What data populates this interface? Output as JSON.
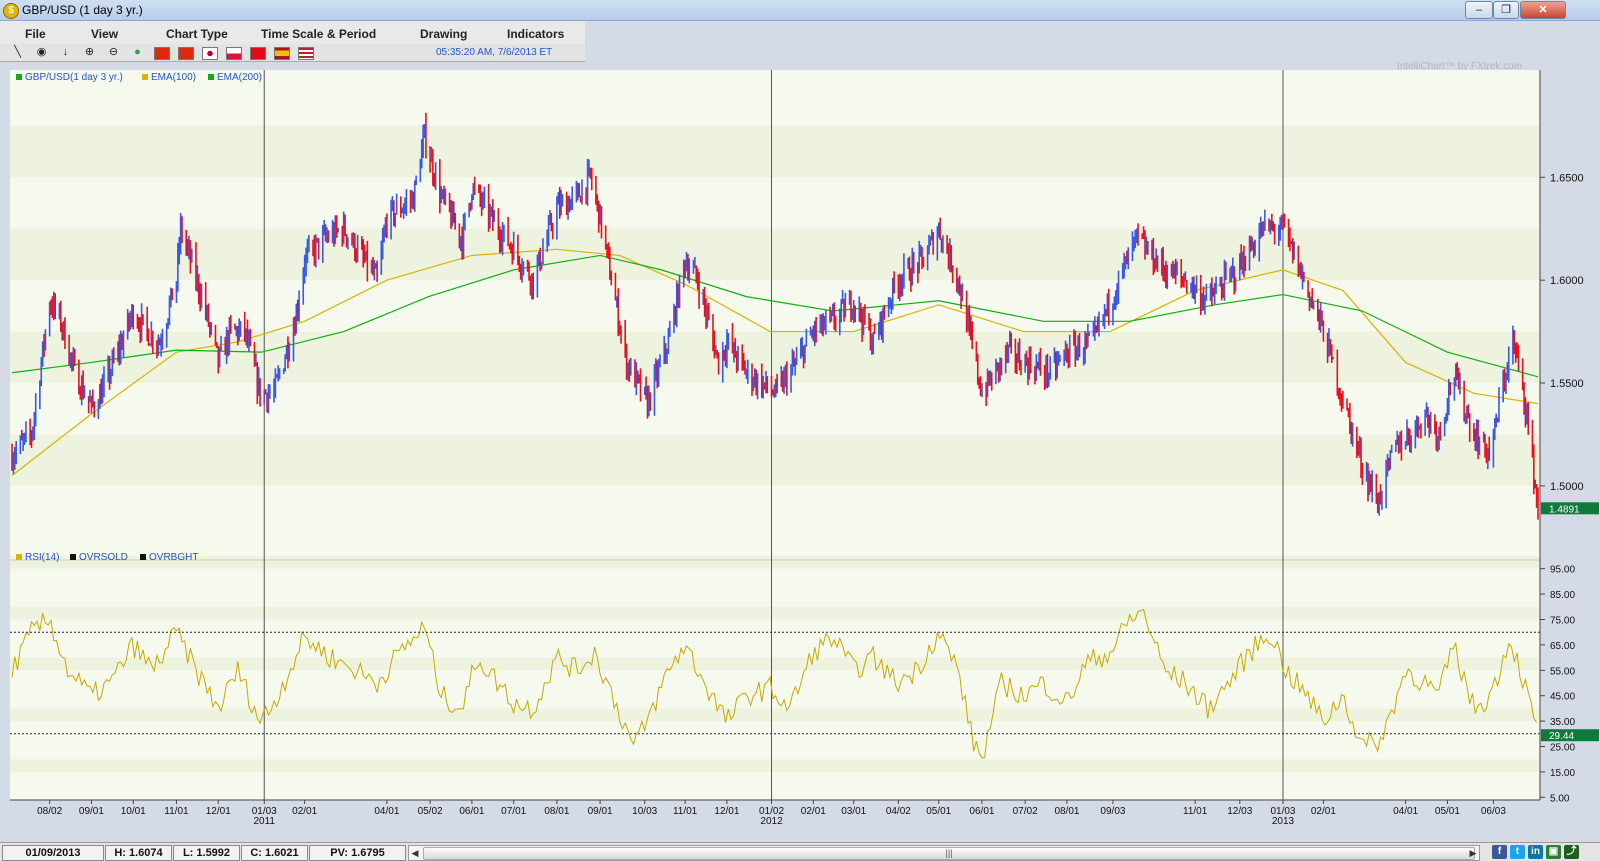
{
  "window": {
    "title": "GBP/USD (1 day  3 yr.)",
    "app_icon_glyph": "$",
    "minimize": "–",
    "restore": "❐",
    "close": "✕"
  },
  "menu": [
    "File",
    "View",
    "Chart Type",
    "Time Scale & Period",
    "Drawing",
    "Indicators"
  ],
  "toolbar": {
    "datetime": "05:35:20 AM, 7/6/2013 ET",
    "tools": [
      "line-tool-icon",
      "target-icon",
      "down-arrow-icon",
      "zoom-in-icon",
      "zoom-out-icon",
      "globe-icon"
    ],
    "flags": [
      "china-flag-icon",
      "hong-kong-flag-icon",
      "japan-flag-icon",
      "poland-flag-icon",
      "turkey-flag-icon",
      "spain-flag-icon",
      "usa-flag-icon"
    ]
  },
  "branding": "IntelliChart™ by FXtrek.com",
  "status": {
    "date": "01/09/2013",
    "high": "H: 1.6074",
    "low": "L: 1.5992",
    "close": "C: 1.6021",
    "pv": "PV: 1.6795",
    "scroll_grip": "|||"
  },
  "colors": {
    "up": "#3858e8",
    "down": "#e8101c",
    "ema100": "#d8b400",
    "ema200": "#10b010",
    "rsi": "#c8a800",
    "price_tag": "#0f7a3c"
  },
  "chart_data": [
    {
      "type": "candlestick",
      "legend": [
        "GBP/USD(1 day  3 yr.)",
        "EMA(100)",
        "EMA(200)"
      ],
      "y_ticks": [
        "1.6500",
        "1.6000",
        "1.5500",
        "1.5000"
      ],
      "ylim": [
        1.463,
        1.69
      ],
      "last_price": "1.4891",
      "x_ticks": [
        {
          "label": "08/02",
          "sub": ""
        },
        {
          "label": "09/01",
          "sub": ""
        },
        {
          "label": "10/01",
          "sub": ""
        },
        {
          "label": "11/01",
          "sub": ""
        },
        {
          "label": "12/01",
          "sub": ""
        },
        {
          "label": "01/03",
          "sub": "2011"
        },
        {
          "label": "02/01",
          "sub": ""
        },
        {
          "label": "04/01",
          "sub": ""
        },
        {
          "label": "05/02",
          "sub": ""
        },
        {
          "label": "06/01",
          "sub": ""
        },
        {
          "label": "07/01",
          "sub": ""
        },
        {
          "label": "08/01",
          "sub": ""
        },
        {
          "label": "09/01",
          "sub": ""
        },
        {
          "label": "10/03",
          "sub": ""
        },
        {
          "label": "11/01",
          "sub": ""
        },
        {
          "label": "12/01",
          "sub": ""
        },
        {
          "label": "01/02",
          "sub": "2012"
        },
        {
          "label": "02/01",
          "sub": ""
        },
        {
          "label": "03/01",
          "sub": ""
        },
        {
          "label": "04/02",
          "sub": ""
        },
        {
          "label": "05/01",
          "sub": ""
        },
        {
          "label": "06/01",
          "sub": ""
        },
        {
          "label": "07/02",
          "sub": ""
        },
        {
          "label": "08/01",
          "sub": ""
        },
        {
          "label": "09/03",
          "sub": ""
        },
        {
          "label": "11/01",
          "sub": ""
        },
        {
          "label": "12/03",
          "sub": ""
        },
        {
          "label": "01/03",
          "sub": "2013"
        },
        {
          "label": "02/01",
          "sub": ""
        },
        {
          "label": "04/01",
          "sub": ""
        },
        {
          "label": "05/01",
          "sub": ""
        },
        {
          "label": "06/03",
          "sub": ""
        }
      ],
      "year_markers": [
        "01/03 2011",
        "01/02 2012",
        "01/03 2013"
      ],
      "close_path": [
        [
          "2010-07-06",
          1.515
        ],
        [
          "2010-07-20",
          1.525
        ],
        [
          "2010-08-02",
          1.59
        ],
        [
          "2010-08-10",
          1.58
        ],
        [
          "2010-08-20",
          1.555
        ],
        [
          "2010-09-01",
          1.538
        ],
        [
          "2010-09-08",
          1.545
        ],
        [
          "2010-09-20",
          1.565
        ],
        [
          "2010-10-01",
          1.585
        ],
        [
          "2010-10-10",
          1.575
        ],
        [
          "2010-10-20",
          1.57
        ],
        [
          "2010-11-01",
          1.6
        ],
        [
          "2010-11-04",
          1.625
        ],
        [
          "2010-11-20",
          1.59
        ],
        [
          "2010-12-01",
          1.56
        ],
        [
          "2010-12-10",
          1.575
        ],
        [
          "2010-12-20",
          1.575
        ],
        [
          "2010-12-31",
          1.545
        ],
        [
          "2011-01-10",
          1.545
        ],
        [
          "2011-01-25",
          1.58
        ],
        [
          "2011-02-01",
          1.61
        ],
        [
          "2011-02-15",
          1.62
        ],
        [
          "2011-03-01",
          1.625
        ],
        [
          "2011-03-15",
          1.61
        ],
        [
          "2011-03-25",
          1.6
        ],
        [
          "2011-04-01",
          1.63
        ],
        [
          "2011-04-20",
          1.64
        ],
        [
          "2011-04-28",
          1.67
        ],
        [
          "2011-05-10",
          1.64
        ],
        [
          "2011-05-25",
          1.62
        ],
        [
          "2011-06-01",
          1.645
        ],
        [
          "2011-06-15",
          1.63
        ],
        [
          "2011-07-01",
          1.615
        ],
        [
          "2011-07-15",
          1.6
        ],
        [
          "2011-08-01",
          1.635
        ],
        [
          "2011-08-15",
          1.64
        ],
        [
          "2011-08-25",
          1.65
        ],
        [
          "2011-09-01",
          1.63
        ],
        [
          "2011-09-20",
          1.56
        ],
        [
          "2011-10-05",
          1.54
        ],
        [
          "2011-10-20",
          1.57
        ],
        [
          "2011-11-01",
          1.61
        ],
        [
          "2011-11-10",
          1.6
        ],
        [
          "2011-11-25",
          1.56
        ],
        [
          "2011-12-01",
          1.57
        ],
        [
          "2011-12-15",
          1.555
        ],
        [
          "2011-12-25",
          1.55
        ],
        [
          "2012-01-05",
          1.545
        ],
        [
          "2012-01-20",
          1.56
        ],
        [
          "2012-02-01",
          1.575
        ],
        [
          "2012-02-15",
          1.58
        ],
        [
          "2012-03-01",
          1.59
        ],
        [
          "2012-03-15",
          1.57
        ],
        [
          "2012-04-01",
          1.6
        ],
        [
          "2012-04-20",
          1.61
        ],
        [
          "2012-05-01",
          1.625
        ],
        [
          "2012-05-15",
          1.6
        ],
        [
          "2012-06-01",
          1.545
        ],
        [
          "2012-06-20",
          1.565
        ],
        [
          "2012-07-02",
          1.56
        ],
        [
          "2012-07-20",
          1.555
        ],
        [
          "2012-08-01",
          1.565
        ],
        [
          "2012-08-20",
          1.57
        ],
        [
          "2012-09-01",
          1.59
        ],
        [
          "2012-09-20",
          1.62
        ],
        [
          "2012-10-10",
          1.605
        ],
        [
          "2012-10-25",
          1.6
        ],
        [
          "2012-11-10",
          1.59
        ],
        [
          "2012-12-01",
          1.605
        ],
        [
          "2012-12-20",
          1.625
        ],
        [
          "2013-01-03",
          1.625
        ],
        [
          "2013-01-15",
          1.605
        ],
        [
          "2013-02-01",
          1.575
        ],
        [
          "2013-02-20",
          1.53
        ],
        [
          "2013-03-01",
          1.51
        ],
        [
          "2013-03-12",
          1.492
        ],
        [
          "2013-03-25",
          1.52
        ],
        [
          "2013-04-05",
          1.525
        ],
        [
          "2013-04-15",
          1.535
        ],
        [
          "2013-04-25",
          1.525
        ],
        [
          "2013-05-05",
          1.555
        ],
        [
          "2013-05-20",
          1.525
        ],
        [
          "2013-06-01",
          1.515
        ],
        [
          "2013-06-10",
          1.55
        ],
        [
          "2013-06-17",
          1.57
        ],
        [
          "2013-06-25",
          1.545
        ],
        [
          "2013-07-05",
          1.489
        ]
      ],
      "ema100_path": [
        [
          "2010-07-06",
          1.505
        ],
        [
          "2010-09-01",
          1.535
        ],
        [
          "2010-11-01",
          1.565
        ],
        [
          "2010-12-15",
          1.57
        ],
        [
          "2011-02-01",
          1.58
        ],
        [
          "2011-04-01",
          1.6
        ],
        [
          "2011-06-01",
          1.612
        ],
        [
          "2011-08-01",
          1.615
        ],
        [
          "2011-09-15",
          1.612
        ],
        [
          "2011-11-01",
          1.598
        ],
        [
          "2012-01-01",
          1.575
        ],
        [
          "2012-03-01",
          1.575
        ],
        [
          "2012-05-01",
          1.588
        ],
        [
          "2012-07-01",
          1.575
        ],
        [
          "2012-09-01",
          1.575
        ],
        [
          "2012-11-01",
          1.595
        ],
        [
          "2013-01-03",
          1.605
        ],
        [
          "2013-02-15",
          1.595
        ],
        [
          "2013-04-01",
          1.56
        ],
        [
          "2013-05-20",
          1.545
        ],
        [
          "2013-07-05",
          1.54
        ]
      ],
      "ema200_path": [
        [
          "2010-07-06",
          1.555
        ],
        [
          "2010-09-01",
          1.56
        ],
        [
          "2010-11-01",
          1.566
        ],
        [
          "2011-01-01",
          1.565
        ],
        [
          "2011-03-01",
          1.575
        ],
        [
          "2011-05-01",
          1.592
        ],
        [
          "2011-07-01",
          1.605
        ],
        [
          "2011-09-01",
          1.612
        ],
        [
          "2011-10-15",
          1.605
        ],
        [
          "2011-12-15",
          1.592
        ],
        [
          "2012-02-15",
          1.585
        ],
        [
          "2012-05-01",
          1.59
        ],
        [
          "2012-07-15",
          1.58
        ],
        [
          "2012-09-15",
          1.58
        ],
        [
          "2012-11-15",
          1.588
        ],
        [
          "2013-01-03",
          1.593
        ],
        [
          "2013-03-01",
          1.585
        ],
        [
          "2013-05-01",
          1.565
        ],
        [
          "2013-07-05",
          1.553
        ]
      ]
    },
    {
      "type": "line",
      "legend": [
        "RSI(14)",
        "OVRSOLD",
        "OVRBGHT"
      ],
      "y_ticks": [
        "95.00",
        "85.00",
        "75.00",
        "65.00",
        "55.00",
        "45.00",
        "35.00",
        "25.00",
        "15.00",
        "5.00"
      ],
      "ylim": [
        0,
        100
      ],
      "oversold": 30,
      "overbought": 70,
      "last_value": "29.44",
      "rsi_path": [
        [
          "2010-07-06",
          55
        ],
        [
          "2010-07-20",
          70
        ],
        [
          "2010-08-02",
          75
        ],
        [
          "2010-08-15",
          55
        ],
        [
          "2010-09-01",
          45
        ],
        [
          "2010-09-15",
          50
        ],
        [
          "2010-10-01",
          65
        ],
        [
          "2010-10-15",
          55
        ],
        [
          "2010-11-01",
          70
        ],
        [
          "2010-11-15",
          55
        ],
        [
          "2010-12-01",
          40
        ],
        [
          "2010-12-15",
          55
        ],
        [
          "2010-12-31",
          35
        ],
        [
          "2011-01-10",
          42
        ],
        [
          "2011-02-01",
          68
        ],
        [
          "2011-02-20",
          60
        ],
        [
          "2011-03-10",
          55
        ],
        [
          "2011-03-25",
          50
        ],
        [
          "2011-04-10",
          62
        ],
        [
          "2011-04-28",
          72
        ],
        [
          "2011-05-10",
          45
        ],
        [
          "2011-05-25",
          40
        ],
        [
          "2011-06-05",
          60
        ],
        [
          "2011-06-20",
          50
        ],
        [
          "2011-07-01",
          42
        ],
        [
          "2011-07-15",
          40
        ],
        [
          "2011-08-01",
          60
        ],
        [
          "2011-08-15",
          55
        ],
        [
          "2011-08-28",
          62
        ],
        [
          "2011-09-10",
          45
        ],
        [
          "2011-09-25",
          25
        ],
        [
          "2011-10-05",
          35
        ],
        [
          "2011-10-20",
          55
        ],
        [
          "2011-11-01",
          65
        ],
        [
          "2011-11-15",
          50
        ],
        [
          "2011-12-01",
          35
        ],
        [
          "2011-12-15",
          45
        ],
        [
          "2012-01-01",
          48
        ],
        [
          "2012-01-15",
          40
        ],
        [
          "2012-02-01",
          62
        ],
        [
          "2012-02-15",
          68
        ],
        [
          "2012-03-01",
          55
        ],
        [
          "2012-03-15",
          60
        ],
        [
          "2012-04-01",
          50
        ],
        [
          "2012-04-15",
          55
        ],
        [
          "2012-05-01",
          70
        ],
        [
          "2012-05-15",
          55
        ],
        [
          "2012-05-25",
          28
        ],
        [
          "2012-06-01",
          20
        ],
        [
          "2012-06-15",
          50
        ],
        [
          "2012-07-01",
          45
        ],
        [
          "2012-07-15",
          50
        ],
        [
          "2012-08-01",
          42
        ],
        [
          "2012-08-15",
          58
        ],
        [
          "2012-09-01",
          62
        ],
        [
          "2012-09-15",
          75
        ],
        [
          "2012-09-25",
          78
        ],
        [
          "2012-10-10",
          55
        ],
        [
          "2012-10-25",
          50
        ],
        [
          "2012-11-10",
          40
        ],
        [
          "2012-11-25",
          50
        ],
        [
          "2012-12-10",
          62
        ],
        [
          "2012-12-25",
          70
        ],
        [
          "2013-01-05",
          55
        ],
        [
          "2013-01-20",
          45
        ],
        [
          "2013-02-01",
          35
        ],
        [
          "2013-02-15",
          45
        ],
        [
          "2013-03-01",
          25
        ],
        [
          "2013-03-15",
          28
        ],
        [
          "2013-04-01",
          55
        ],
        [
          "2013-04-15",
          50
        ],
        [
          "2013-04-25",
          45
        ],
        [
          "2013-05-05",
          65
        ],
        [
          "2013-05-20",
          40
        ],
        [
          "2013-06-01",
          45
        ],
        [
          "2013-06-15",
          68
        ],
        [
          "2013-06-25",
          50
        ],
        [
          "2013-07-05",
          29.44
        ]
      ]
    }
  ]
}
